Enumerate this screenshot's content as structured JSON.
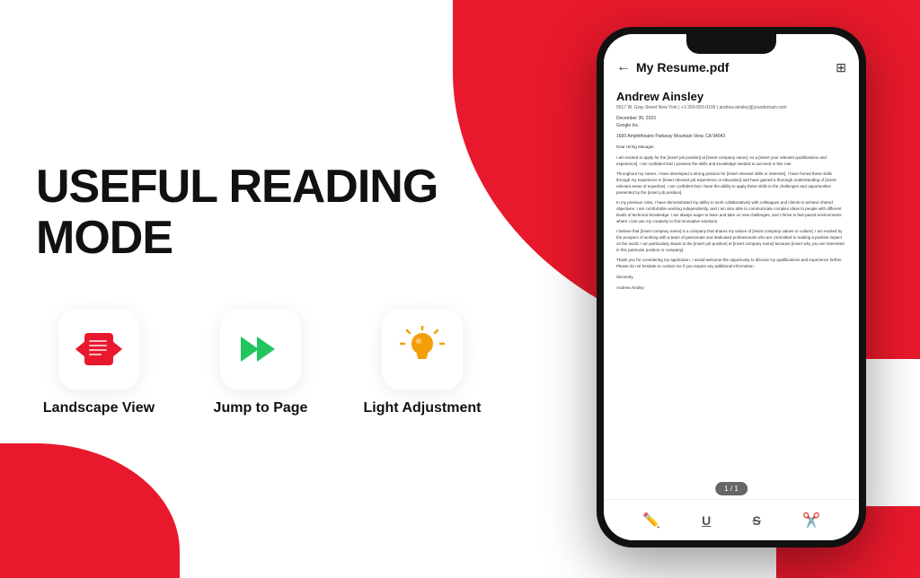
{
  "background": {
    "primary_color": "#e8192c",
    "secondary_color": "#ffffff"
  },
  "left_panel": {
    "title": "USEFUL READING MODE",
    "features": [
      {
        "id": "landscape-view",
        "label": "Landscape View",
        "icon_type": "landscape",
        "icon_color": "#e8192c"
      },
      {
        "id": "jump-to-page",
        "label": "Jump to Page",
        "icon_type": "jump",
        "icon_color": "#22c55e"
      },
      {
        "id": "light-adjustment",
        "label": "Light Adjustment",
        "icon_type": "light",
        "icon_color": "#f59e0b"
      }
    ]
  },
  "phone_mockup": {
    "header": {
      "back_label": "←",
      "title": "My Resume.pdf",
      "menu_icon": "⊞"
    },
    "pdf": {
      "resume_name": "Andrew Ainsley",
      "contact": "5517 W. Gray Street  New York | +1-300-555-0199 | andrew.ainsley@yourdomain.com",
      "date": "December 30, 2023",
      "company_name": "Google Inc.",
      "company_address": "1600 Amphitheatre Parkway Mountain View, CA 94043",
      "salutation": "Dear Hiring Manager,",
      "paragraphs": [
        "I am excited to apply for the [insert job position] at [insert company name]. As a [insert your relevant qualifications and experience], I am confident that I possess the skills and knowledge needed to succeed in this role.",
        "Throughout my career, I have developed a strong passion for [insert relevant skills or interests]. I have honed these skills through my experience in [insert relevant job experience or education] and have gained a thorough understanding of [insert relevant areas of expertise]. I am confident that I have the ability to apply these skills to the challenges and opportunities presented by the [insert job position].",
        "In my previous roles, I have demonstrated my ability to work collaboratively with colleagues and clients to achieve shared objectives. I am comfortable working independently, and I am also able to communicate complex ideas to people with different levels of technical knowledge. I am always eager to learn and take on new challenges, and I thrive in fast-paced environments where I can use my creativity to find innovative solutions.",
        "I believe that [insert company name] is a company that shares my values of [insert company values or culture]. I am excited by the prospect of working with a team of passionate and dedicated professionals who are committed to making a positive impact on the world. I am particularly drawn to the [insert job position] at [insert company name] because [insert why you are interested in this particular position or company].",
        "Thank you for considering my application. I would welcome the opportunity to discuss my qualifications and experience further. Please do not hesitate to contact me if you require any additional information.",
        "Sincerely,",
        "Andrew Ainsley"
      ]
    },
    "page_indicator": "1 / 1",
    "toolbar_icons": [
      "✏️",
      "U",
      "S",
      "✂️"
    ]
  }
}
